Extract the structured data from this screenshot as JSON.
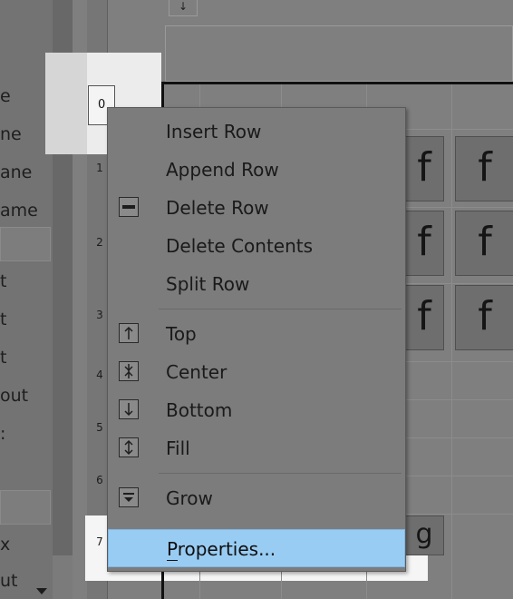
{
  "left_panel": {
    "labels": [
      "e",
      "ne",
      "ane",
      "ame",
      "t",
      "t",
      "t",
      "out",
      ":",
      "x",
      "ut"
    ]
  },
  "row_headers": [
    "0",
    "1",
    "2",
    "3",
    "4",
    "5",
    "6",
    "7"
  ],
  "top_icon": "↓",
  "cell_glyph": "f",
  "partial_glyph": "g",
  "context_menu": {
    "items": [
      {
        "label": "Insert Row",
        "icon": null
      },
      {
        "label": "Append Row",
        "icon": null
      },
      {
        "label": "Delete Row",
        "icon": "delete-row-icon"
      },
      {
        "label": "Delete Contents",
        "icon": null
      },
      {
        "label": "Split Row",
        "icon": null
      },
      {
        "label": "Top",
        "icon": "align-top-icon"
      },
      {
        "label": "Center",
        "icon": "align-center-icon"
      },
      {
        "label": "Bottom",
        "icon": "align-bottom-icon"
      },
      {
        "label": "Fill",
        "icon": "fill-icon"
      },
      {
        "label": "Grow",
        "icon": "grow-icon"
      },
      {
        "label": "Properties...",
        "icon": null,
        "selected": true
      }
    ]
  },
  "colors": {
    "selection": "#99ccf3",
    "overlay": "#7c7c7c"
  }
}
